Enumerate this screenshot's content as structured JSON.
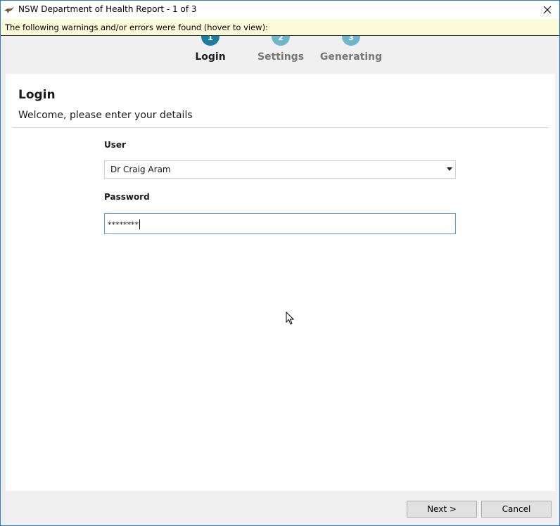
{
  "window": {
    "title": "NSW Department of Health Report - 1 of 3",
    "icon": "bird-logo-icon",
    "close_icon": "close-icon"
  },
  "warning": {
    "text": "The following warnings and/or errors were found (hover to view):"
  },
  "steps": [
    {
      "number": "1",
      "label": "Login",
      "state": "active"
    },
    {
      "number": "2",
      "label": "Settings",
      "state": "inactive"
    },
    {
      "number": "3",
      "label": "Generating",
      "state": "inactive"
    }
  ],
  "page": {
    "title": "Login",
    "subtitle": "Welcome, please enter your details"
  },
  "form": {
    "user_label": "User",
    "user_value": "Dr Craig Aram",
    "password_label": "Password",
    "password_value": "********"
  },
  "footer": {
    "next_label": "Next >",
    "cancel_label": "Cancel"
  },
  "colors": {
    "active_step": "#1a7f9e",
    "inactive_step": "#6fb6cc",
    "warning_bg": "#fbfbd9",
    "window_border": "#2b7bd6"
  }
}
